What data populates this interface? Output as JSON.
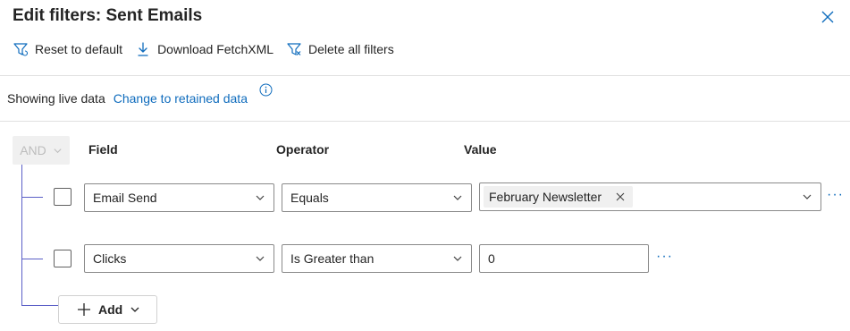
{
  "header": {
    "title": "Edit filters: Sent Emails"
  },
  "toolbar": {
    "reset_label": "Reset to default",
    "download_label": "Download FetchXML",
    "delete_label": "Delete all filters"
  },
  "data_mode": {
    "status": "Showing live data",
    "link": "Change to retained data"
  },
  "filter": {
    "group_operator": "AND",
    "columns": {
      "field": "Field",
      "operator": "Operator",
      "value": "Value"
    },
    "rows": [
      {
        "field": "Email Send",
        "operator": "Equals",
        "value": "February Newsletter"
      },
      {
        "field": "Clicks",
        "operator": "Is Greater than",
        "value": "0"
      }
    ],
    "add_label": "Add",
    "more_label": "···"
  },
  "colors": {
    "accent": "#0f6cbd",
    "tree_line": "#5b5fc7"
  }
}
